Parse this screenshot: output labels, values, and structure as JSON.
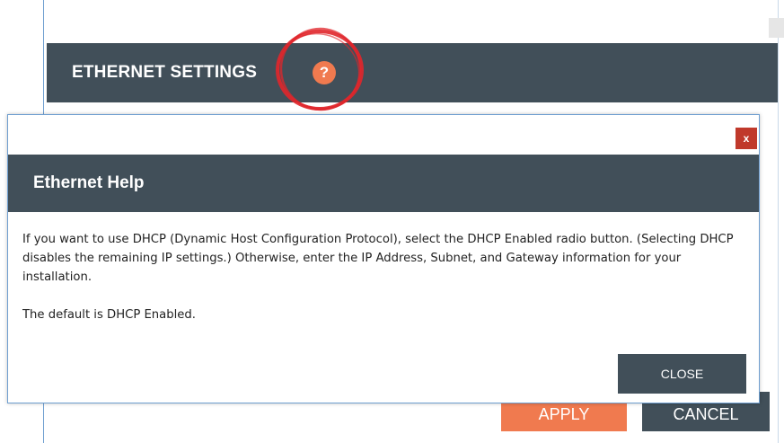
{
  "background_window": {
    "section_title": "ETHERNET SETTINGS",
    "help_icon_glyph": "?",
    "apply_label": "APPLY",
    "cancel_label": "CANCEL"
  },
  "modal": {
    "close_x_label": "x",
    "title": "Ethernet Help",
    "paragraphs": [
      "If you want to use DHCP (Dynamic Host Configuration Protocol), select the DHCP Enabled radio button. (Selecting DHCP disables the remaining IP settings.) Otherwise, enter the IP Address, Subnet, and Gateway information for your installation.",
      "The default is DHCP Enabled."
    ],
    "close_label": "CLOSE"
  },
  "colors": {
    "header_bg": "#414f59",
    "accent_orange": "#f07a4f",
    "close_x_red": "#c0392b",
    "annotation_red": "#e0262b"
  },
  "icons": {
    "help": "question-circle-icon",
    "close": "close-icon"
  }
}
